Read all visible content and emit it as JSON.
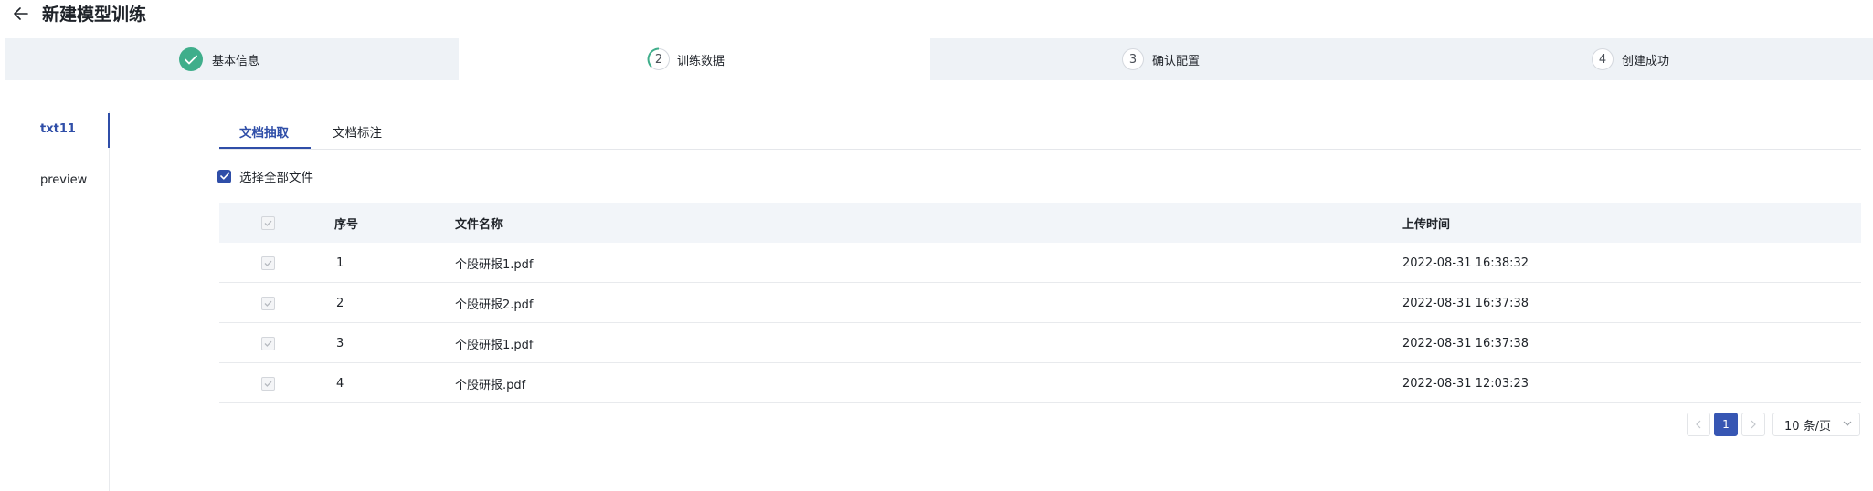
{
  "header": {
    "title": "新建模型训练"
  },
  "steps": [
    {
      "num": "1",
      "label": "基本信息",
      "state": "done"
    },
    {
      "num": "2",
      "label": "训练数据",
      "state": "active"
    },
    {
      "num": "3",
      "label": "确认配置",
      "state": "pending"
    },
    {
      "num": "4",
      "label": "创建成功",
      "state": "pending"
    }
  ],
  "sidebar": {
    "items": [
      {
        "label": "txt11"
      },
      {
        "label": "preview"
      }
    ]
  },
  "tabs": [
    {
      "label": "文档抽取"
    },
    {
      "label": "文档标注"
    }
  ],
  "select_all_label": "选择全部文件",
  "table": {
    "columns": {
      "index": "序号",
      "name": "文件名称",
      "time": "上传时间"
    },
    "rows": [
      {
        "index": "1",
        "name": "个股研报1.pdf",
        "time": "2022-08-31 16:38:32"
      },
      {
        "index": "2",
        "name": "个股研报2.pdf",
        "time": "2022-08-31 16:37:38"
      },
      {
        "index": "3",
        "name": "个股研报1.pdf",
        "time": "2022-08-31 16:37:38"
      },
      {
        "index": "4",
        "name": "个股研报.pdf",
        "time": "2022-08-31 12:03:23"
      }
    ]
  },
  "pagination": {
    "current_page": "1",
    "page_size": "10 条/页"
  },
  "colors": {
    "accent": "#2f4ea8",
    "success": "#3fae8b",
    "steps_bg": "#eef2f6"
  }
}
